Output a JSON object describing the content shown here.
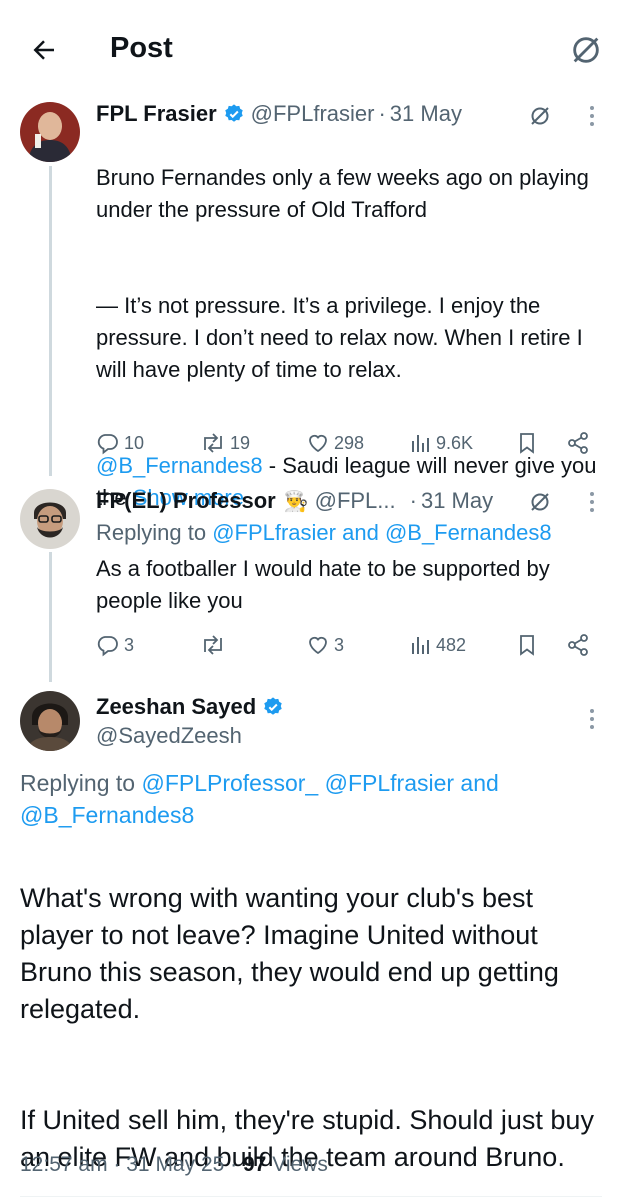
{
  "header": {
    "title": "Post",
    "back_icon": "arrow-left-icon",
    "grok_icon": "grok-slash-icon"
  },
  "tweet1": {
    "name": "FPL Frasier",
    "handle": "@FPLfrasier",
    "separator": "·",
    "date": "31 May",
    "paragraph1": "Bruno Fernandes only a few weeks ago on playing under the pressure of Old Trafford",
    "paragraph2": "— It’s not pressure. It’s a privilege. I enjoy the pressure. I don’t need to relax now. When I retire I will have plenty of time to relax.",
    "mention": "@B_Fernandes8",
    "paragraph3_rest": " - Saudi league will never give you the ",
    "show_more": "Show more",
    "stats": {
      "replies": "10",
      "reposts": "19",
      "likes": "298",
      "views": "9.6K"
    }
  },
  "tweet2": {
    "name": "FP(EL) Professor",
    "emoji": "👨‍🍳",
    "handle": "@FPL...",
    "separator": "·",
    "date": "31 May",
    "replying_prefix": "Replying to ",
    "replying_user1": "@FPLfrasier",
    "replying_and": " and ",
    "replying_user2": "@B_Fernandes8",
    "text": "As a footballer I would hate to be supported by people like you",
    "stats": {
      "replies": "3",
      "reposts": "",
      "likes": "3",
      "views": "482"
    }
  },
  "tweet3": {
    "name": "Zeeshan Sayed",
    "handle": "@SayedZeesh",
    "replying_prefix": "Replying to ",
    "replying_user1": "@FPLProfessor_",
    "replying_user2": "@FPLfrasier",
    "replying_and": " and ",
    "replying_user3": "@B_Fernandes8",
    "paragraph1": "What's wrong with wanting your club's best player to not leave? Imagine United without Bruno this season, they would end up getting relegated.",
    "paragraph2": "If United sell him, they're stupid. Should just buy an elite FW and build the team around Bruno.",
    "time": "12:57 am",
    "separator": "·",
    "date": "31 May 25",
    "views_count": "97",
    "views_label": "Views"
  },
  "colors": {
    "link": "#1d9bf0",
    "muted": "#536471",
    "text": "#0f1419",
    "verified": "#1d9bf0",
    "thread": "#cfd9de"
  }
}
